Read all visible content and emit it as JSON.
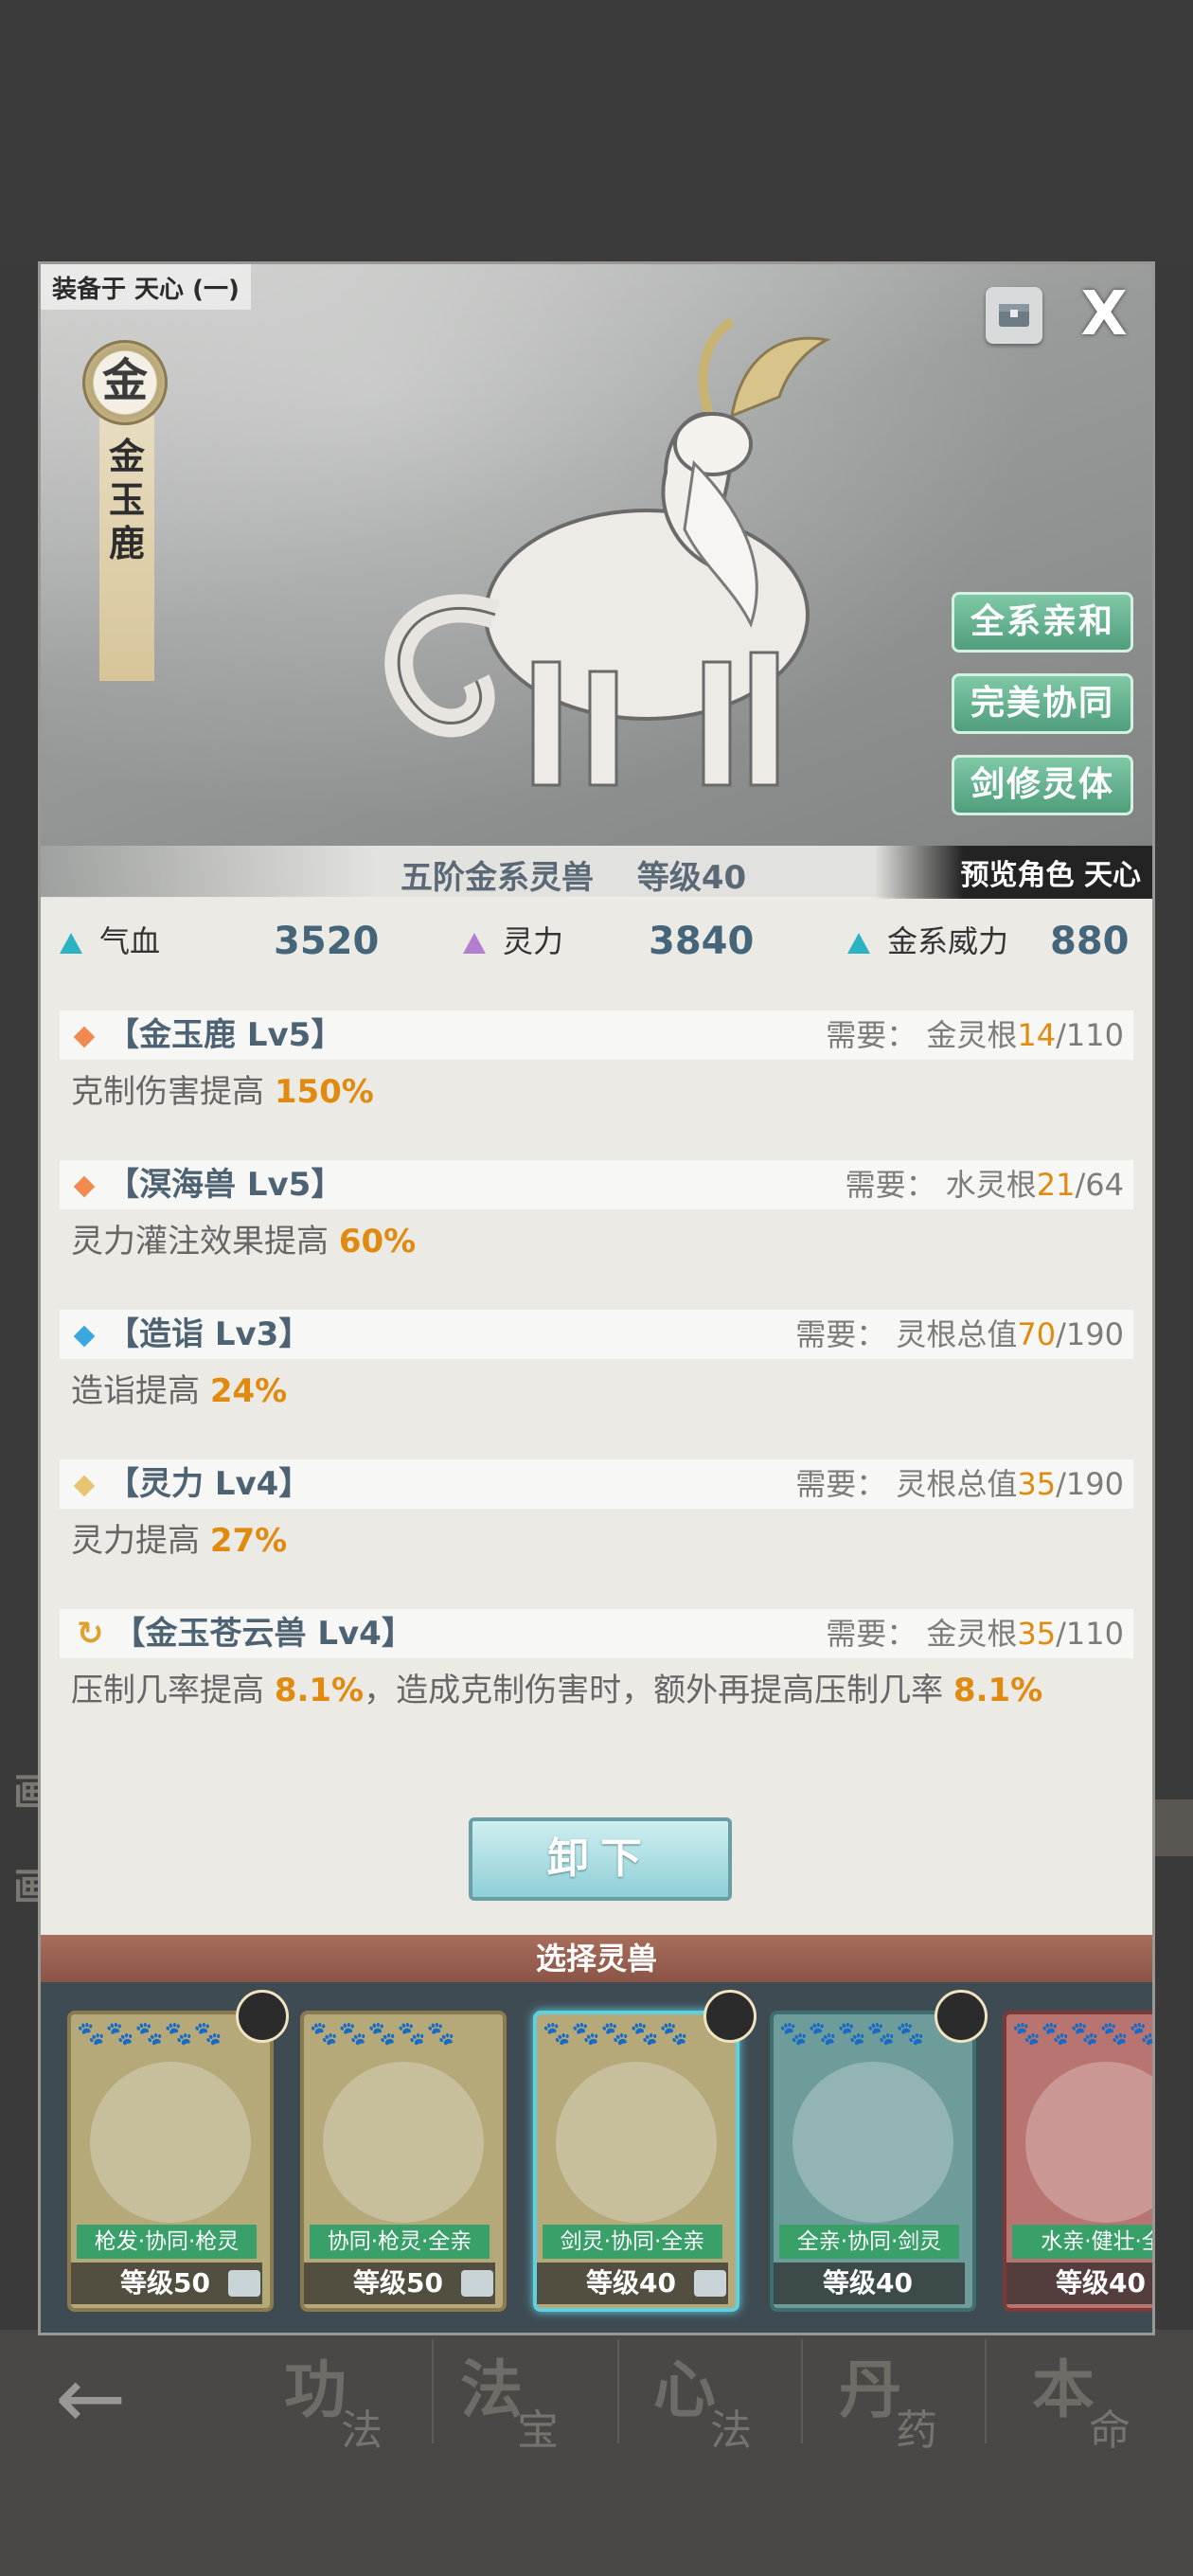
{
  "background": {
    "left_edge_labels": [
      "画",
      "画"
    ],
    "nav": [
      {
        "big": "功",
        "small": "法"
      },
      {
        "big": "法",
        "small": "宝"
      },
      {
        "big": "心",
        "small": "法"
      },
      {
        "big": "丹",
        "small": "药"
      },
      {
        "big": "本",
        "small": "命"
      }
    ]
  },
  "modal": {
    "equipped_label": "装备于 天心 (一)",
    "close_icon": "X",
    "element": "金",
    "beast_name_chars": [
      "金",
      "玉",
      "鹿"
    ],
    "traits": [
      "全系亲和",
      "完美协同",
      "剑修灵体"
    ],
    "hero_title": "五阶金系灵兽　 等级40",
    "preview_label": "预览角色 天心",
    "stats": [
      {
        "label": "气血",
        "value": "3520",
        "color": "#2bb3c4"
      },
      {
        "label": "灵力",
        "value": "3840",
        "color": "#b37ed0"
      },
      {
        "label": "金系威力",
        "value": "880",
        "color": "#2bb3c4"
      }
    ],
    "skills": [
      {
        "name": "【金玉鹿 Lv5】",
        "gem_color": "#f08a50",
        "req_prefix": "需要：  金灵根",
        "req_cur": "14",
        "req_max": "/110",
        "desc": "克制伤害提高 ",
        "desc_hi": "150%"
      },
      {
        "name": "【溟海兽 Lv5】",
        "gem_color": "#f08a50",
        "req_prefix": "需要：  水灵根",
        "req_cur": "21",
        "req_max": "/64",
        "desc": "灵力灌注效果提高 ",
        "desc_hi": "60%"
      },
      {
        "name": "【造诣 Lv3】",
        "gem_color": "#3aa8e0",
        "req_prefix": "需要：  灵根总值",
        "req_cur": "70",
        "req_max": "/190",
        "desc": "造诣提高 ",
        "desc_hi": "24%"
      },
      {
        "name": "【灵力 Lv4】",
        "gem_color": "#e6c470",
        "req_prefix": "需要：  灵根总值",
        "req_cur": "35",
        "req_max": "/190",
        "desc": "灵力提高 ",
        "desc_hi": "27%"
      },
      {
        "name": "【金玉苍云兽 Lv4】",
        "gem_color": "#e0a030",
        "req_prefix": "需要：  金灵根",
        "req_cur": "35",
        "req_max": "/110",
        "desc": "压制几率提高 ",
        "desc_hi": "8.1%",
        "desc2": "，造成克制伤害时，额外再提高压制几率 ",
        "desc2_hi": "8.1%"
      }
    ],
    "unequip_label": "卸下",
    "select_label": "选择灵兽",
    "cards": [
      {
        "tags": "枪发·协同·枪灵",
        "level": "等级50",
        "paws": "🐾🐾🐾🐾🐾"
      },
      {
        "tags": "协同·枪灵·全亲",
        "level": "等级50",
        "paws": "🐾🐾🐾🐾🐾"
      },
      {
        "tags": "剑灵·协同·全亲",
        "level": "等级40",
        "paws": "🐾🐾🐾🐾🐾"
      },
      {
        "tags": "全亲·协同·剑灵",
        "level": "等级40",
        "paws": "🐾🐾🐾🐾🐾"
      },
      {
        "tags": "水亲·健壮·全",
        "level": "等级40",
        "paws": "🐾🐾🐾🐾🐾"
      }
    ]
  }
}
